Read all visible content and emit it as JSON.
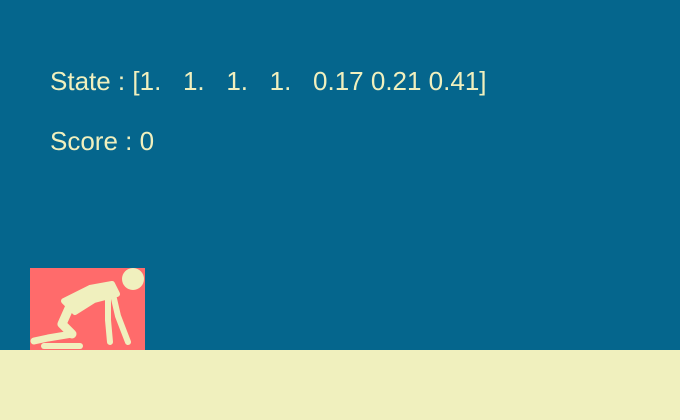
{
  "hud": {
    "state_label": "State : ",
    "state_value": "[1.   1.   1.   1.   0.17 0.21 0.41]",
    "score_label": "Score : ",
    "score_value": "0"
  },
  "colors": {
    "background": "#05668d",
    "ground": "#f0f0be",
    "player_box": "#ff6b6b",
    "player_figure": "#f0f0be",
    "hud_text": "#f0f0be"
  },
  "player": {
    "icon": "crawling-person-icon"
  }
}
